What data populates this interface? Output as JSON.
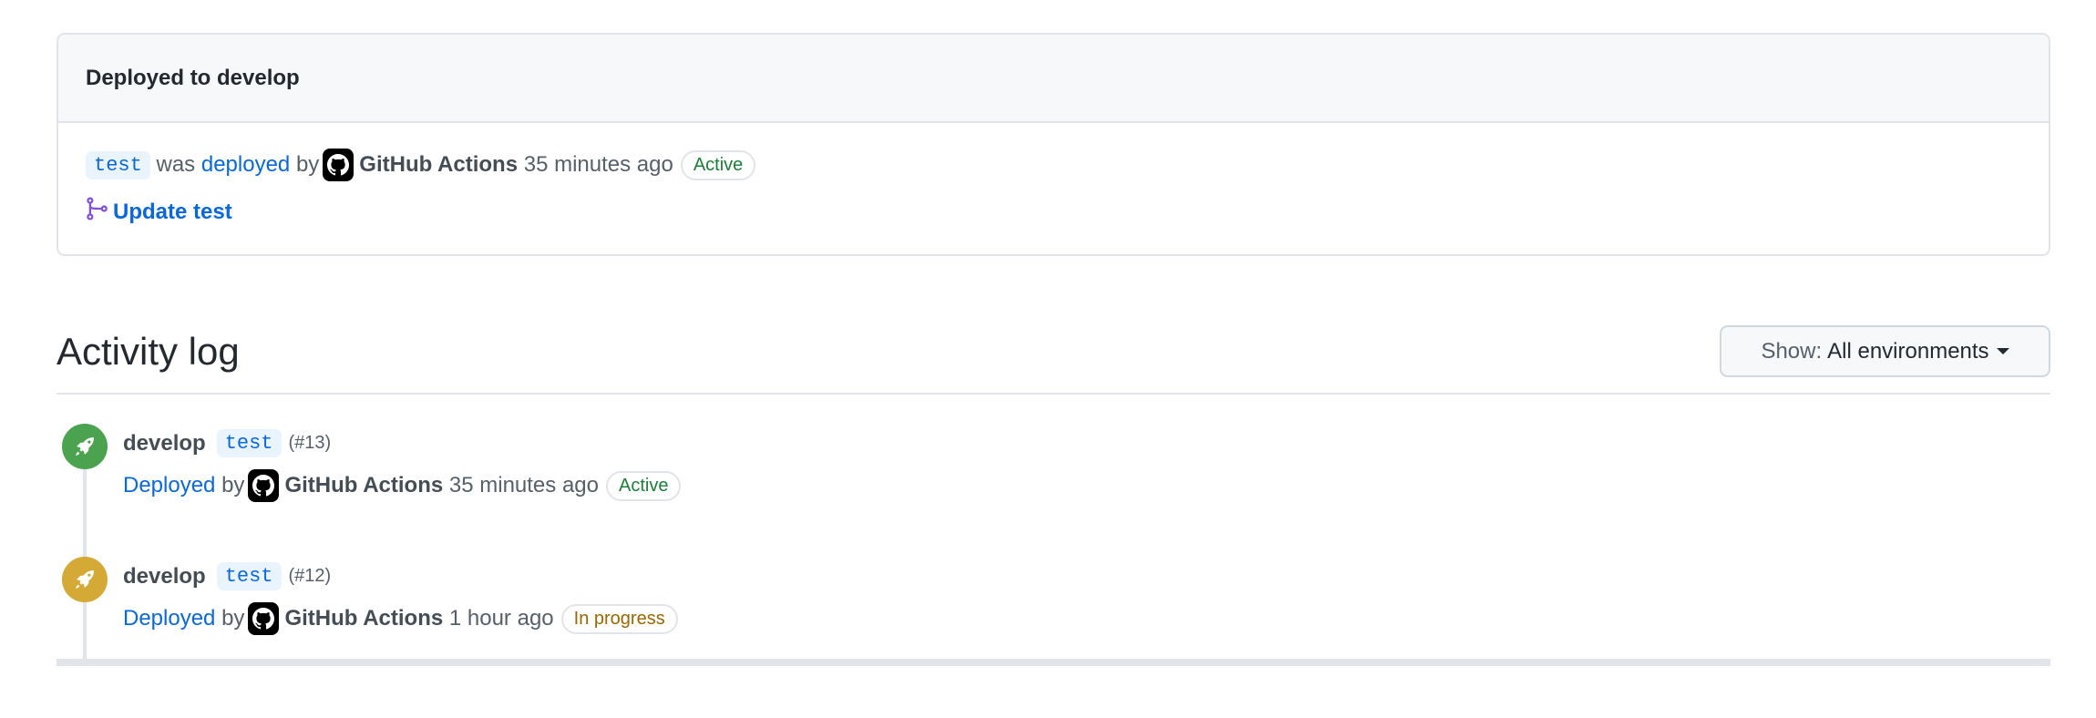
{
  "deployment": {
    "title": "Deployed to develop",
    "ref": "test",
    "was": "was",
    "deployed_link": "deployed",
    "by": "by",
    "actor": "GitHub Actions",
    "time": "35 minutes ago",
    "status": "Active",
    "commit": "Update test"
  },
  "activity": {
    "title": "Activity log",
    "filter_label": "Show:",
    "filter_value": "All environments",
    "entries": [
      {
        "env": "develop",
        "ref": "test",
        "number": "(#13)",
        "action": "Deployed",
        "by": "by",
        "actor": "GitHub Actions",
        "time": "35 minutes ago",
        "status": "Active",
        "color": "#4ca34f"
      },
      {
        "env": "develop",
        "ref": "test",
        "number": "(#12)",
        "action": "Deployed",
        "by": "by",
        "actor": "GitHub Actions",
        "time": "1 hour ago",
        "status": "In progress",
        "color": "#d4a936"
      }
    ]
  }
}
